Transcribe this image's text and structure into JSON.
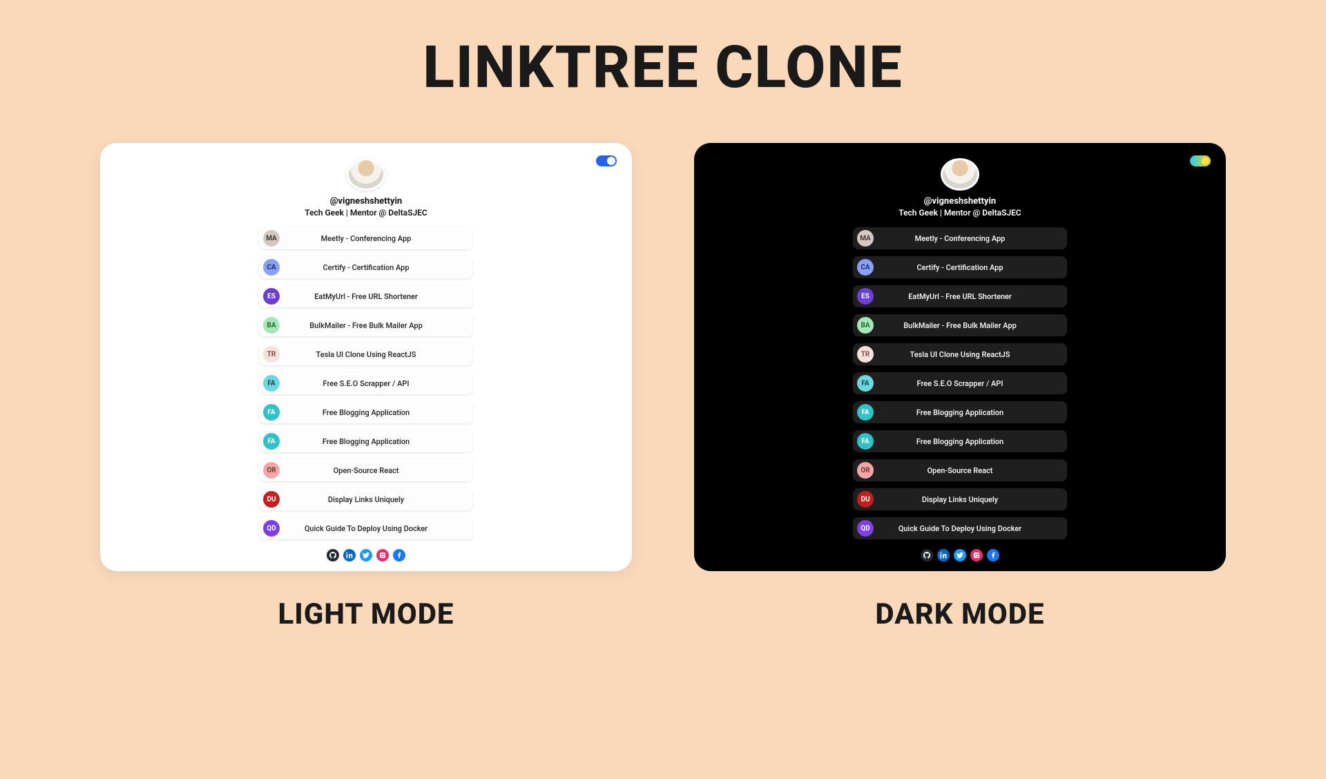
{
  "title": "LINKTREE CLONE",
  "captions": {
    "light": "LIGHT MODE",
    "dark": "DARK MODE"
  },
  "profile": {
    "username": "@vigneshshettyin",
    "bio": "Tech Geek | Mentor @ DeltaSJEC"
  },
  "links": [
    {
      "badge": "MA",
      "label": "Meetly - Conferencing App",
      "badge_bg": "#d7c9c0",
      "badge_fg": "#3a3a3a"
    },
    {
      "badge": "CA",
      "label": "Certify - Certification App",
      "badge_bg": "#8aa0f2",
      "badge_fg": "#1e2a6e"
    },
    {
      "badge": "ES",
      "label": "EatMyUrl - Free URL Shortener",
      "badge_bg": "#6b3fd1",
      "badge_fg": "#ffffff"
    },
    {
      "badge": "BA",
      "label": "BulkMailer - Free Bulk Mailer App",
      "badge_bg": "#a7e6b6",
      "badge_fg": "#1e6b2f"
    },
    {
      "badge": "TR",
      "label": "Tesla UI Clone Using ReactJS",
      "badge_bg": "#f3e1dc",
      "badge_fg": "#7a4a4a"
    },
    {
      "badge": "FA",
      "label": "Free S.E.O Scrapper / API",
      "badge_bg": "#6fd6df",
      "badge_fg": "#0b4a52"
    },
    {
      "badge": "FA",
      "label": "Free Blogging Application",
      "badge_bg": "#2ec2c9",
      "badge_fg": "#ffffff"
    },
    {
      "badge": "FA",
      "label": "Free Blogging Application",
      "badge_bg": "#2ec2c9",
      "badge_fg": "#ffffff"
    },
    {
      "badge": "OR",
      "label": "Open-Source React",
      "badge_bg": "#f2a7a7",
      "badge_fg": "#7a2e2e"
    },
    {
      "badge": "DU",
      "label": "Display Links Uniquely",
      "badge_bg": "#c21f1f",
      "badge_fg": "#ffffff"
    },
    {
      "badge": "QD",
      "label": "Quick Guide To Deploy Using Docker",
      "badge_bg": "#7b3fe4",
      "badge_fg": "#ffffff"
    }
  ],
  "socials": [
    {
      "name": "github",
      "bg": "#24292e"
    },
    {
      "name": "linkedin",
      "bg": "#0a66c2"
    },
    {
      "name": "twitter",
      "bg": "#1d9bf0"
    },
    {
      "name": "instagram",
      "bg": "#e1306c"
    },
    {
      "name": "facebook",
      "bg": "#1877f2"
    }
  ]
}
